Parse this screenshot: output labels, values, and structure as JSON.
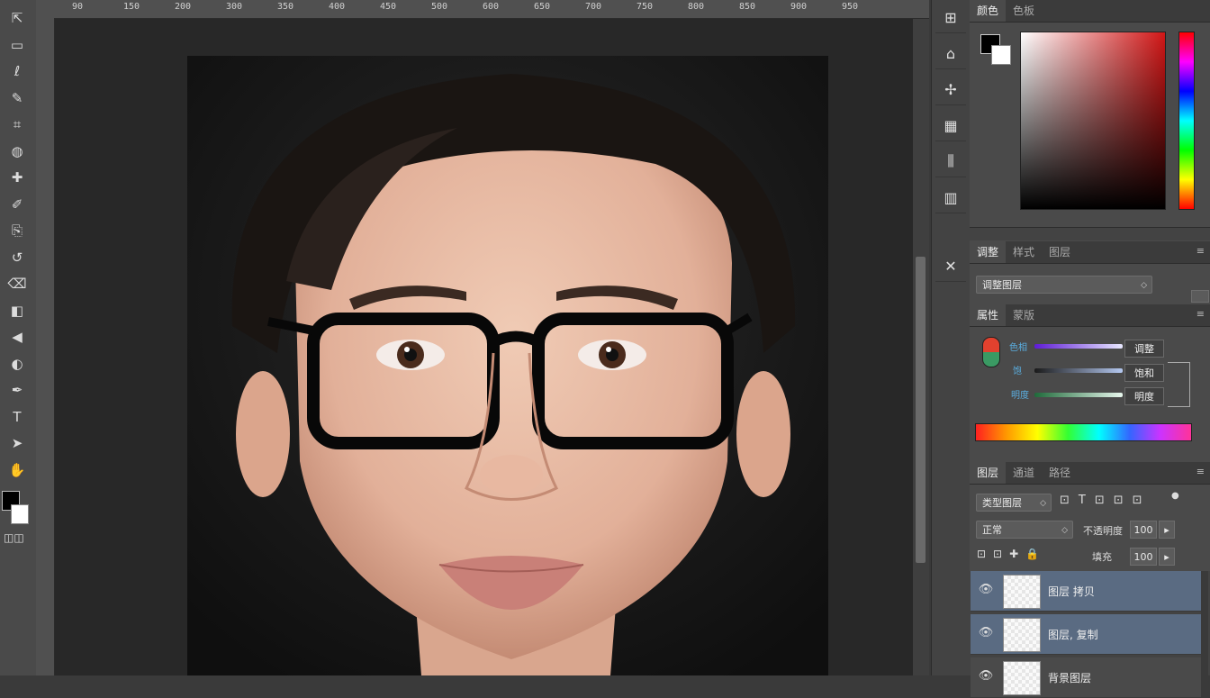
{
  "toolbar": {
    "tools": [
      {
        "name": "move-tool",
        "glyph": "⇱"
      },
      {
        "name": "marquee-tool",
        "glyph": "▭"
      },
      {
        "name": "lasso-tool",
        "glyph": "ℓ"
      },
      {
        "name": "quick-select-tool",
        "glyph": "✎"
      },
      {
        "name": "crop-tool",
        "glyph": "⌗"
      },
      {
        "name": "eyedropper-tool",
        "glyph": "◍"
      },
      {
        "name": "healing-tool",
        "glyph": "✚"
      },
      {
        "name": "brush-tool",
        "glyph": "✐"
      },
      {
        "name": "clone-tool",
        "glyph": "⎘"
      },
      {
        "name": "history-brush-tool",
        "glyph": "↺"
      },
      {
        "name": "eraser-tool",
        "glyph": "⌫"
      },
      {
        "name": "gradient-tool",
        "glyph": "◧"
      },
      {
        "name": "blur-tool",
        "glyph": "◀"
      },
      {
        "name": "dodge-tool",
        "glyph": "◐"
      },
      {
        "name": "pen-tool",
        "glyph": "✒"
      },
      {
        "name": "type-tool",
        "glyph": "T"
      },
      {
        "name": "path-select-tool",
        "glyph": "➤"
      },
      {
        "name": "hand-tool",
        "glyph": "✋"
      }
    ],
    "fg_color": "#000000",
    "bg_color": "#ffffff"
  },
  "ruler": {
    "labels": [
      "90",
      "150",
      "200",
      "300",
      "350",
      "400",
      "450",
      "500",
      "600",
      "650",
      "700",
      "750",
      "800",
      "850",
      "900",
      "950"
    ]
  },
  "iconcol": {
    "icons": [
      "history-icon",
      "properties-icon",
      "adjust-icon",
      "channels-icon",
      "paths-icon",
      "histogram-icon",
      "brush-settings-icon"
    ]
  },
  "color_panel": {
    "tabs": [
      "颜色",
      "色板"
    ],
    "fg": "#000000",
    "bg": "#ffffff",
    "hue": "#d11616"
  },
  "adjust_panel": {
    "tabs": [
      "调整",
      "样式",
      "图层"
    ],
    "dropdown": "调整图层"
  },
  "hsl_panel": {
    "tabs": [
      "属性",
      "蒙版"
    ],
    "rows": [
      {
        "label": "色相",
        "value": "调整"
      },
      {
        "label": "饱",
        "value": "饱和"
      },
      {
        "label": "明度",
        "value": "明度"
      }
    ]
  },
  "layers_panel": {
    "tabs": [
      "图层",
      "通道",
      "路径"
    ],
    "kind_dropdown": "类型图层",
    "blend_dropdown": "正常",
    "opacity_label": "不透明度",
    "opacity_value": "100",
    "lock_label": "锁定",
    "fill_label": "填充",
    "fill_value": "100",
    "layers": [
      {
        "name": "图层 拷贝"
      },
      {
        "name": "图层, 复制"
      },
      {
        "name": "背景图层"
      }
    ]
  },
  "colors": {
    "panel_bg": "#4a4a4a",
    "canvas_bg": "#282828",
    "layer_selected": "#5a6b82"
  }
}
